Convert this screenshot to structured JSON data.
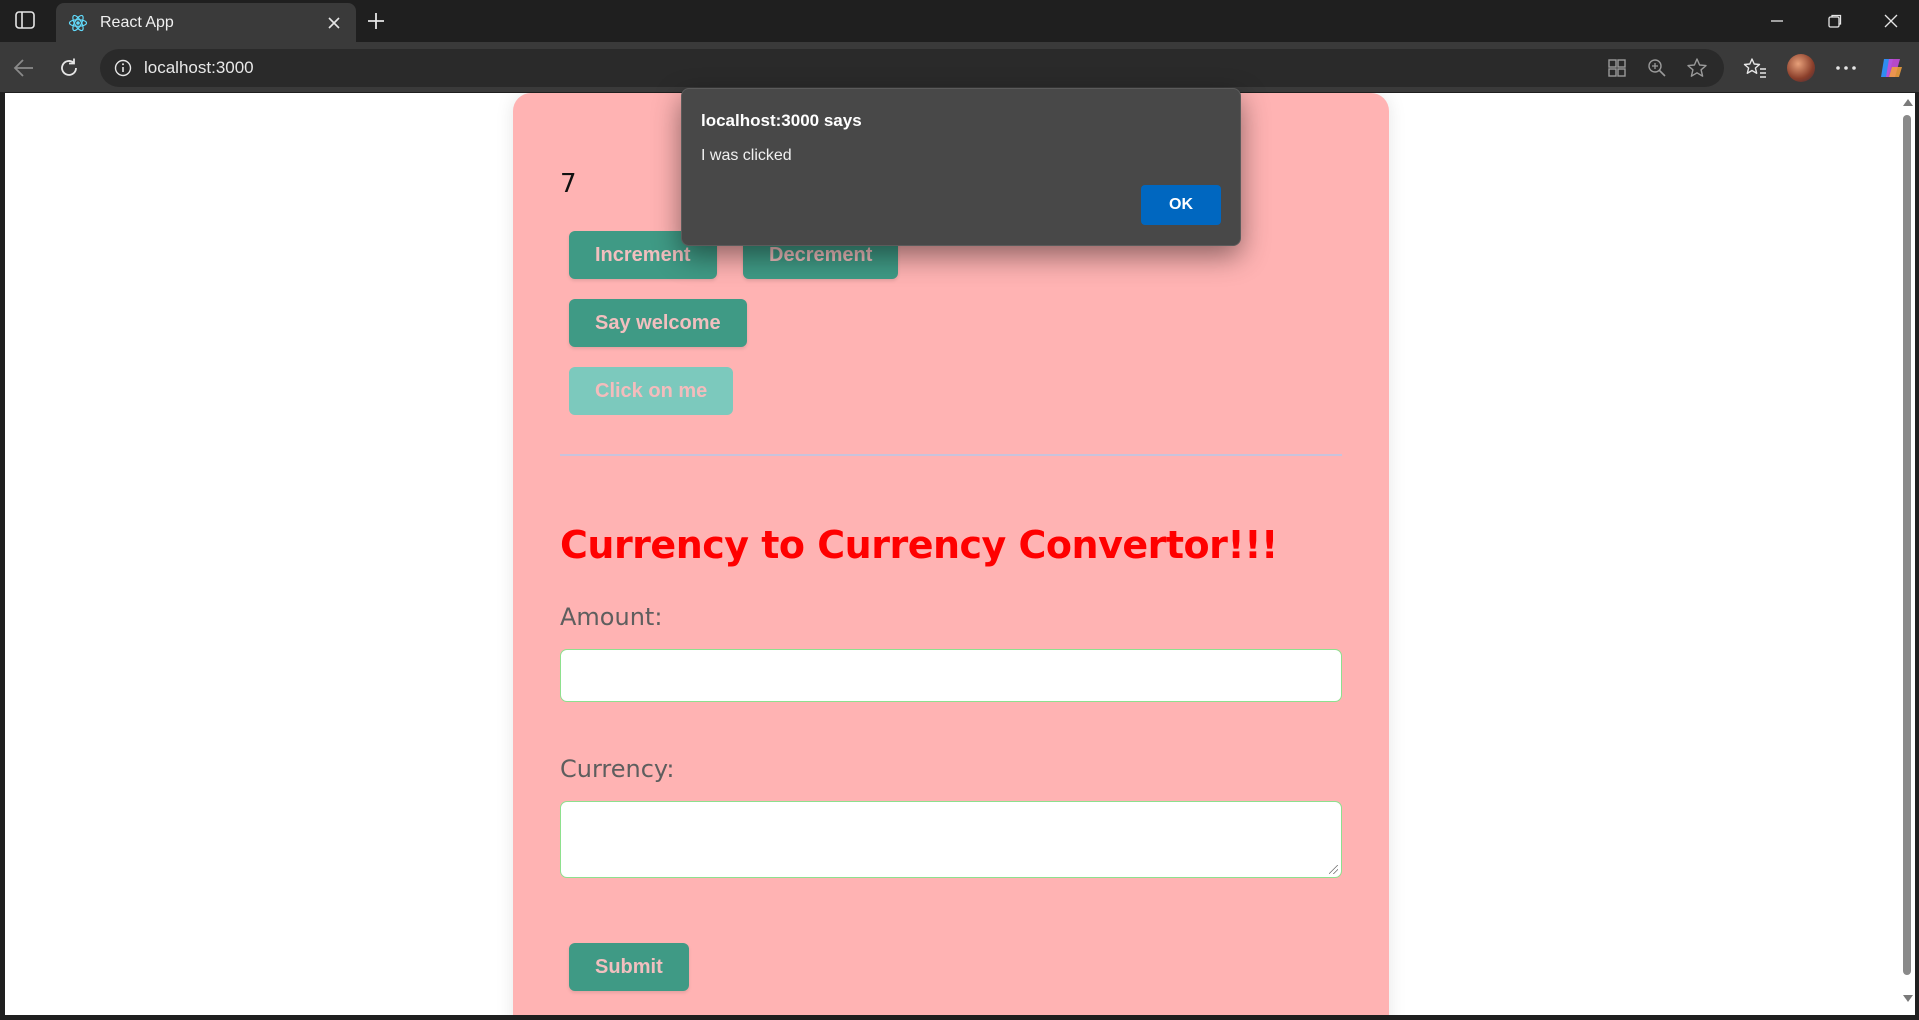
{
  "browser": {
    "tab": {
      "title": "React App",
      "favicon": "react-logo-icon"
    },
    "address_bar": {
      "url": "localhost:3000"
    },
    "icons": {
      "sidebar": "sidebar-toggle-icon",
      "close_tab": "close-icon",
      "new_tab": "plus-icon",
      "back": "back-arrow-icon",
      "reload": "reload-icon",
      "site_info": "info-icon",
      "app_available": "app-grid-icon",
      "zoom": "zoom-icon",
      "favorite": "star-icon",
      "favorites": "favorites-icon",
      "more": "more-icon",
      "copilot": "copilot-icon"
    }
  },
  "app": {
    "counter_value": "7",
    "buttons": {
      "increment": "Increment",
      "decrement": "Decrement",
      "say_welcome": "Say welcome",
      "click_on_me": "Click on me",
      "submit": "Submit"
    },
    "converter": {
      "heading": "Currency to Currency Convertor!!!",
      "amount_label": "Amount:",
      "amount_value": "",
      "currency_label": "Currency:",
      "currency_value": ""
    }
  },
  "dialog": {
    "title": "localhost:3000 says",
    "message": "I was clicked",
    "ok_label": "OK"
  },
  "colors": {
    "card_background": "#ffb3b3",
    "button_background": "#3f9a85",
    "heading": "#ff0000",
    "dialog_ok": "#0067c0"
  }
}
